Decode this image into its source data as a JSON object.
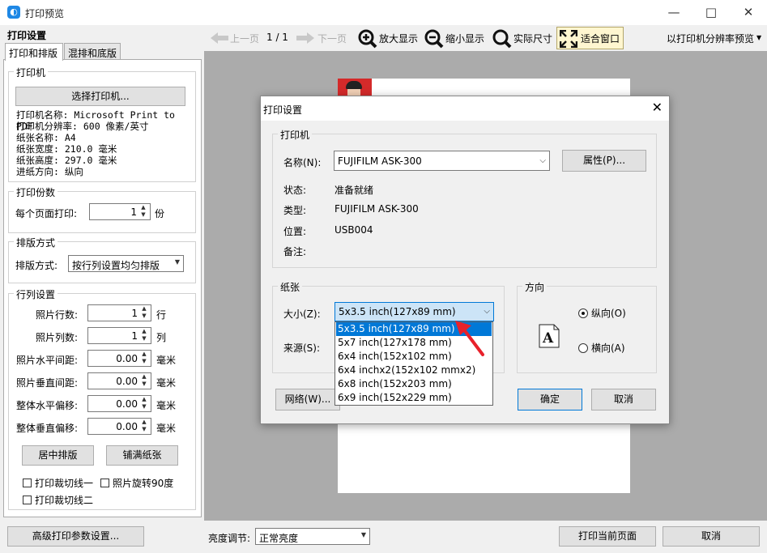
{
  "window": {
    "title": "打印预览",
    "icon": "app-logo-icon"
  },
  "left": {
    "heading": "打印设置",
    "tabs": [
      "打印和排版",
      "混排和底版"
    ],
    "printer": {
      "group_title": "打印机",
      "select_button": "选择打印机...",
      "lines": [
        "打印机名称: Microsoft Print to PDF",
        "打印机分辨率: 600 像素/英寸",
        "纸张名称: A4",
        "纸张宽度: 210.0 毫米",
        "纸张高度: 297.0 毫米",
        "进纸方向: 纵向"
      ]
    },
    "copies": {
      "group_title": "打印份数",
      "label": "每个页面打印:",
      "value": "1",
      "unit": "份"
    },
    "layout": {
      "group_title": "排版方式",
      "label": "排版方式:",
      "value": "按行列设置均匀排版"
    },
    "rowcol": {
      "group_title": "行列设置",
      "rows": [
        {
          "label": "照片行数:",
          "value": "1",
          "unit": "行"
        },
        {
          "label": "照片列数:",
          "value": "1",
          "unit": "列"
        },
        {
          "label": "照片水平间距:",
          "value": "0.00",
          "unit": "毫米"
        },
        {
          "label": "照片垂直间距:",
          "value": "0.00",
          "unit": "毫米"
        },
        {
          "label": "整体水平偏移:",
          "value": "0.00",
          "unit": "毫米"
        },
        {
          "label": "整体垂直偏移:",
          "value": "0.00",
          "unit": "毫米"
        }
      ],
      "center_button": "居中排版",
      "fill_button": "铺满纸张",
      "checks": [
        "打印裁切线一",
        "照片旋转90度",
        "打印裁切线二"
      ]
    }
  },
  "toolbar": {
    "prev": "上一页",
    "page": "1 / 1",
    "next": "下一页",
    "zoom_in": "放大显示",
    "zoom_out": "缩小显示",
    "actual": "实际尺寸",
    "fit": "适合窗口",
    "mode": "以打印机分辨率预览"
  },
  "bottom": {
    "advanced_button": "高级打印参数设置...",
    "brightness_label": "亮度调节:",
    "brightness_value": "正常亮度",
    "print_button": "打印当前页面",
    "cancel_button": "取消"
  },
  "dialog": {
    "title": "打印设置",
    "printer_group": "打印机",
    "name_label": "名称(N):",
    "name_value": "FUJIFILM ASK-300",
    "properties_button": "属性(P)...",
    "status_label": "状态:",
    "status_value": "准备就绪",
    "type_label": "类型:",
    "type_value": "FUJIFILM ASK-300",
    "where_label": "位置:",
    "where_value": "USB004",
    "comment_label": "备注:",
    "paper_group": "纸张",
    "size_label": "大小(Z):",
    "size_value": "5x3.5 inch(127x89 mm)",
    "source_label": "来源(S):",
    "orientation_group": "方向",
    "portrait": "纵向(O)",
    "landscape": "横向(A)",
    "network_button": "网络(W)...",
    "ok_button": "确定",
    "cancel_button": "取消",
    "size_options": [
      "5x3.5 inch(127x89 mm)",
      "5x7 inch(127x178 mm)",
      "6x4 inch(152x102 mm)",
      "6x4 inchx2(152x102 mmx2)",
      "6x8 inch(152x203 mm)",
      "6x9 inch(152x229 mm)"
    ]
  }
}
